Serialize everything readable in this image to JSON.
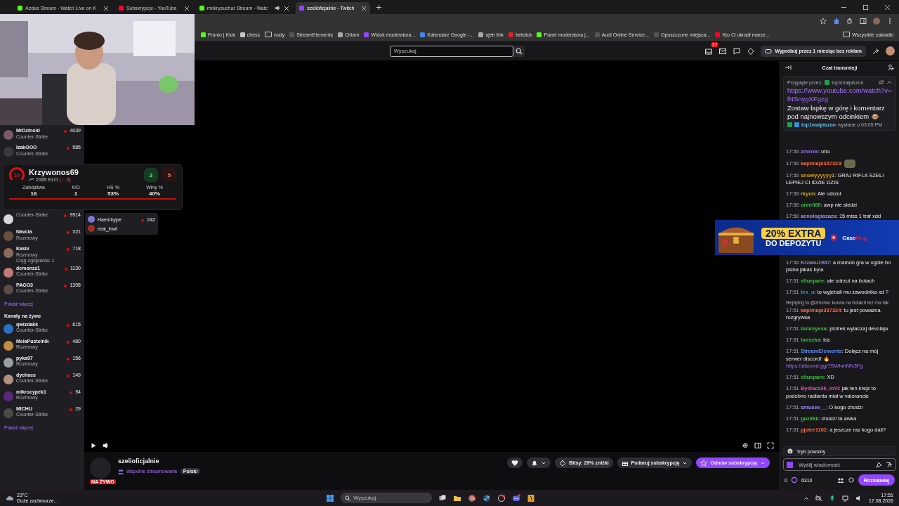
{
  "browser": {
    "tabs": [
      {
        "title": "Azdus Stream - Watch Live on K",
        "kind": "kick",
        "audio": false,
        "selected": false
      },
      {
        "title": "Subskrypcje - YouTube",
        "kind": "youtube",
        "audio": false,
        "selected": false
      },
      {
        "title": "mokrysuchar Stream - Watc",
        "kind": "kick",
        "audio": true,
        "selected": false
      },
      {
        "title": "szelioficjalnie - Twitch",
        "kind": "twitch",
        "audio": false,
        "selected": true
      }
    ],
    "bookmarks": [
      {
        "label": "Franio | Kick",
        "kind": "kick"
      },
      {
        "label": "chess",
        "kind": "pawn"
      },
      {
        "label": "nudy",
        "kind": "folder"
      },
      {
        "label": "StreamElements",
        "kind": "dark"
      },
      {
        "label": "Chlam",
        "kind": "globe"
      },
      {
        "label": "Widok moderatora...",
        "kind": "twitch"
      },
      {
        "label": "Kalendarz Google -...",
        "kind": "calendar"
      },
      {
        "label": "ujeb link",
        "kind": "globe"
      },
      {
        "label": "betclick",
        "kind": "red"
      },
      {
        "label": "Panel moderatora |...",
        "kind": "kick"
      },
      {
        "label": "Audi Online Service...",
        "kind": "dark"
      },
      {
        "label": "Opuszczone miejsca...",
        "kind": "dark"
      },
      {
        "label": "Kto Ci ukradł marze...",
        "kind": "youtube"
      }
    ],
    "all_bookmarks": "Wszystkie zakładki"
  },
  "topnav": {
    "search": {
      "placeholder": "Wyszukaj"
    },
    "notifications": "37",
    "promo": "Wypróbuj przez 1 miesiąc bez reklam"
  },
  "sidebar": {
    "followed": [
      {
        "name": "MrDzinold",
        "category": "Counter-Strike",
        "viewers": "4039",
        "color": "#7a5a6a"
      },
      {
        "name": "IzakOOO",
        "category": "Counter-Strike",
        "viewers": "585",
        "color": "#3a3a3a"
      },
      {
        "category": "Counter-Strike",
        "viewers": "9914",
        "color": "#d8d8d8"
      },
      {
        "name": "Navcia",
        "category": "Rozmowy",
        "viewers": "321",
        "color": "#6a5040"
      },
      {
        "name": "Kasix",
        "category": "Rozmowy",
        "viewers": "718",
        "streak": "Ciąg oglądania: 1",
        "color": "#8a6a5a"
      },
      {
        "name": "demonzz1",
        "category": "Counter-Strike",
        "viewers": "1130",
        "color": "#c07a7a"
      },
      {
        "name": "PAGO3",
        "category": "Counter-Strike",
        "viewers": "1395",
        "color": "#5a4a4a"
      }
    ],
    "show_more_1": "Pokaż więcej",
    "live_header": "Kanały na żywo",
    "live": [
      {
        "name": "qwizdakk",
        "category": "Counter-Strike",
        "viewers": "615",
        "color": "#2a70c0"
      },
      {
        "name": "MelaPustelnik",
        "category": "Rozmowy",
        "viewers": "480",
        "color": "#c09040"
      },
      {
        "name": "pyka97",
        "category": "Rozmowy",
        "viewers": "156",
        "color": "#9aa0a0"
      },
      {
        "name": "dychacs",
        "category": "Counter-Strike",
        "viewers": "149",
        "color": "#b09080"
      },
      {
        "name": "mikrocypek1",
        "category": "Rozmowy",
        "viewers": "94",
        "color": "#5a2a7a"
      },
      {
        "name": "MICHU",
        "category": "Counter-Strike",
        "viewers": "29",
        "color": "#4a4a4a"
      }
    ],
    "show_more_2": "Pokaż więcej"
  },
  "participants_popup": [
    {
      "name": "Haemhype",
      "viewers": "242",
      "color": "#7a7ad0"
    },
    {
      "name": "real_inwl",
      "color": "#a03020"
    }
  ],
  "stats_overlay": {
    "level": "10",
    "player": "Krzywonos69",
    "elo": "2185 ELO",
    "elo_change": "(↓ -5)",
    "wins": "2",
    "losses": "5",
    "stats": [
      {
        "label": "Zabójstwa",
        "value": "16"
      },
      {
        "label": "K/D",
        "value": "1"
      },
      {
        "label": "HS %",
        "value": "53%"
      },
      {
        "label": "Winy %",
        "value": "40%"
      }
    ]
  },
  "channel": {
    "name": "szelioficjalnie",
    "live_badge": "NA ŻYWO",
    "collab": "Wspólne streamowanie",
    "tag": "Polski",
    "bits": "Bitsy: 29% zniżki",
    "gift": "Podaruj subskrypcję",
    "renew": "Odnów subskrypcję"
  },
  "chat": {
    "title": "Czat transmisji",
    "pinned": {
      "by_label": "Przypięte przez:",
      "by": "top1malpiszon",
      "link": "https://www.youtube.com/watch?v=lNSnygXFgzg",
      "text": "Zostaw łapkę w górę i komentarz pod najnowszym odcinkiem 🐵",
      "author": "top1malpiszon",
      "sent": "wysłane o 03:05 PM"
    },
    "messages_top": [
      {
        "time": "17:50",
        "user": "zmxnw",
        "color": "#9b6cff",
        "text": ": oho",
        "emote": false
      },
      {
        "time": "17:50",
        "user": "kapimapi337324",
        "color": "#ff6a3a",
        "text": ":",
        "emote": true
      },
      {
        "time": "17:50",
        "user": "snowyyyyyy1",
        "color": "#d4a017",
        "text": ": GRAJ RIFLA SZELI LEPIEJ CI IDZIE DZIS",
        "emote": false
      },
      {
        "time": "17:50",
        "user": "rkyun",
        "color": "#c8b020",
        "text": ": Ale odrzut",
        "emote": false
      },
      {
        "time": "17:50",
        "user": "oren080",
        "color": "#2fbf4f",
        "text": ": awp nie siedzi",
        "emote": false
      },
      {
        "time": "17:50",
        "user": "acnologiazaza",
        "color": "#9b8cff",
        "text": ": 15 miss 1 traf xdd",
        "emote": false
      }
    ],
    "messages": [
      {
        "time": "17:50",
        "user": "Krzaku1987",
        "color": "#7a8fe0",
        "text": ": a mamon gra w ogóle bo psina jakas byla",
        "emote": false
      },
      {
        "time": "17:51",
        "user": "eltuepare",
        "color": "#3cc13c",
        "text": ": ale odrzut na botach",
        "emote": false
      },
      {
        "time": "17:51",
        "user": "tex_u",
        "color": "#21a0c8",
        "text": ": to wyjebali mu zawodnika xd ?",
        "emote": false
      },
      {
        "time": "17:51",
        "user": "kapimapi337324",
        "color": "#ff6a3a",
        "reply": "Replying to @zmxnw: kurwa na botach tez ma tak",
        "text": ": tu jest powazna rozgrywka",
        "emote": false
      },
      {
        "time": "17:51",
        "user": "tommyesa",
        "color": "#3cc13c",
        "text": ": piotrek wylaczaj devolaja",
        "emote": false
      },
      {
        "time": "17:51",
        "user": "breszka",
        "color": "#3cc13c",
        "text": ": Idc",
        "emote": false
      },
      {
        "time": "17:51",
        "user": "StreamElements",
        "color": "#5a8ff6",
        "text": ": Dołącz na mój serwer discord! 🔥",
        "link": "https://discord.gg/7SWhmNN3Fg",
        "emote": false
      },
      {
        "time": "17:51",
        "user": "eltuepare",
        "color": "#3cc13c",
        "text": ": XD",
        "emote": false
      },
      {
        "time": "17:51",
        "user": "Bydlacz3k_inVi",
        "color": "#e04fb0",
        "text": ": jak ten krejz to podobno radianta miał w valorancie",
        "emote": false
      },
      {
        "time": "17:51",
        "user": "smuxee__",
        "color": "#9b8cff",
        "text": ": O kogo chodzi",
        "emote": false
      },
      {
        "time": "17:51",
        "user": "guzlikk",
        "color": "#3cc13c",
        "text": ": chodzi ta awka",
        "emote": false
      },
      {
        "time": "17:51",
        "user": "pjoter1102",
        "color": "#ff6a3a",
        "text": ": a jeszcze raz kogo dali?",
        "emote": false
      }
    ],
    "slow_mode": "Tryb powolny",
    "input": {
      "placeholder": "Wyślij wiadomość"
    },
    "bits": "0",
    "points": "6310",
    "send": "Rozmawiaj"
  },
  "ad": {
    "headline": "20% EXTRA",
    "subline": "DO DEPOZYTU",
    "brand_a": "Case",
    "brand_b": "Hug"
  },
  "taskbar": {
    "temperature": "23°C",
    "weather": "Duże zachmurze...",
    "search": {
      "placeholder": "Wyszukaj"
    },
    "time": "17:51",
    "date": "17.08.2026"
  }
}
